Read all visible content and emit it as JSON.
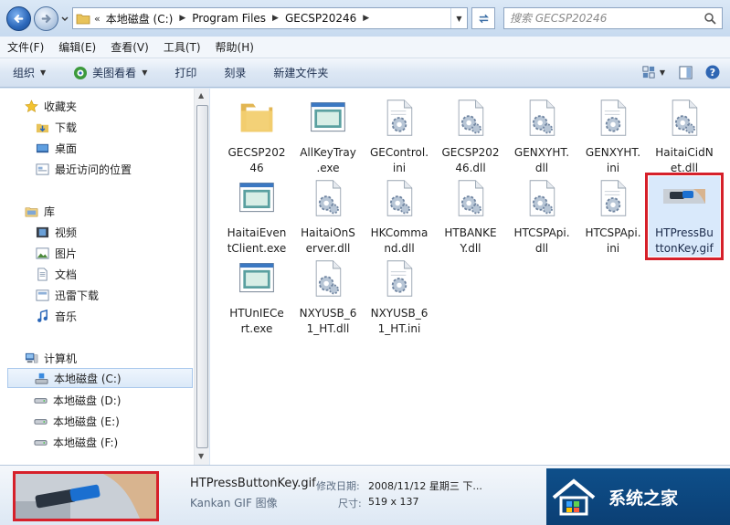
{
  "address_bar": {
    "lead": "«",
    "crumbs": [
      "本地磁盘 (C:)",
      "Program Files",
      "GECSP20246"
    ],
    "search_placeholder": "搜索 GECSP20246"
  },
  "menu": [
    "文件(F)",
    "编辑(E)",
    "查看(V)",
    "工具(T)",
    "帮助(H)"
  ],
  "commands": {
    "organize": "组织",
    "view_with": "美图看看",
    "print": "打印",
    "burn": "刻录",
    "new_folder": "新建文件夹"
  },
  "nav": {
    "favorites": {
      "label": "收藏夹",
      "items": [
        "下载",
        "桌面",
        "最近访问的位置"
      ]
    },
    "libraries": {
      "label": "库",
      "items": [
        "视频",
        "图片",
        "文档",
        "迅雷下载",
        "音乐"
      ]
    },
    "computer": {
      "label": "计算机",
      "items": [
        "本地磁盘 (C:)",
        "本地磁盘 (D:)",
        "本地磁盘 (E:)",
        "本地磁盘 (F:)"
      ],
      "selected_index": 0
    }
  },
  "files": [
    {
      "name": "GECSP20246",
      "type": "folder-icon"
    },
    {
      "name": "AllKeyTray.exe",
      "type": "exe-icon"
    },
    {
      "name": "GEControl.ini",
      "type": "ini-icon"
    },
    {
      "name": "GECSP20246.dll",
      "type": "dll-icon"
    },
    {
      "name": "GENXYHT.dll",
      "type": "dll-icon"
    },
    {
      "name": "GENXYHT.ini",
      "type": "ini-icon"
    },
    {
      "name": "HaitaiCidNet.dll",
      "type": "dll-icon"
    },
    {
      "name": "HaitaiEventClient.exe",
      "type": "exe-icon"
    },
    {
      "name": "HaitaiOnServer.dll",
      "type": "dll-icon"
    },
    {
      "name": "HKCommand.dll",
      "type": "dll-icon"
    },
    {
      "name": "HTBANKEY.dll",
      "type": "dll-icon"
    },
    {
      "name": "HTCSPApi.dll",
      "type": "dll-icon"
    },
    {
      "name": "HTCSPApi.ini",
      "type": "ini-icon"
    },
    {
      "name": "HTPressButtonKey.gif",
      "type": "gif-icon",
      "selected": true
    },
    {
      "name": "HTUnIECert.exe",
      "type": "exe-icon"
    },
    {
      "name": "NXYUSB_61_HT.dll",
      "type": "dll-icon"
    },
    {
      "name": "NXYUSB_61_HT.ini",
      "type": "ini-icon"
    }
  ],
  "file_labels": [
    [
      "GECSP202",
      "46"
    ],
    [
      "AllKeyTray",
      ".exe"
    ],
    [
      "GEControl.",
      "ini"
    ],
    [
      "GECSP202",
      "46.dll"
    ],
    [
      "GENXYHT.",
      "dll"
    ],
    [
      "GENXYHT.",
      "ini"
    ],
    [
      "HaitaiCidN",
      "et.dll"
    ],
    [
      "HaitaiEven",
      "tClient.exe"
    ],
    [
      "HaitaiOnS",
      "erver.dll"
    ],
    [
      "HKComma",
      "nd.dll"
    ],
    [
      "HTBANKE",
      "Y.dll"
    ],
    [
      "HTCSPApi.",
      "dll"
    ],
    [
      "HTCSPApi.",
      "ini"
    ],
    [
      "HTPressBu",
      "ttonKey.gif"
    ],
    [
      "HTUnIECe",
      "rt.exe"
    ],
    [
      "NXYUSB_6",
      "1_HT.dll"
    ],
    [
      "NXYUSB_6",
      "1_HT.ini"
    ]
  ],
  "details": {
    "name": "HTPressButtonKey.gif",
    "type": "Kankan GIF 图像",
    "modified_key": "修改日期:",
    "modified_value": "2008/11/12 星期三 下...",
    "size_key": "尺寸:",
    "size_value": "519 x 137"
  },
  "watermark": {
    "text": "系统之家"
  },
  "colors": {
    "highlight": "#d6202a",
    "selection": "#d9e9fb",
    "accent": "#2b67b9"
  }
}
